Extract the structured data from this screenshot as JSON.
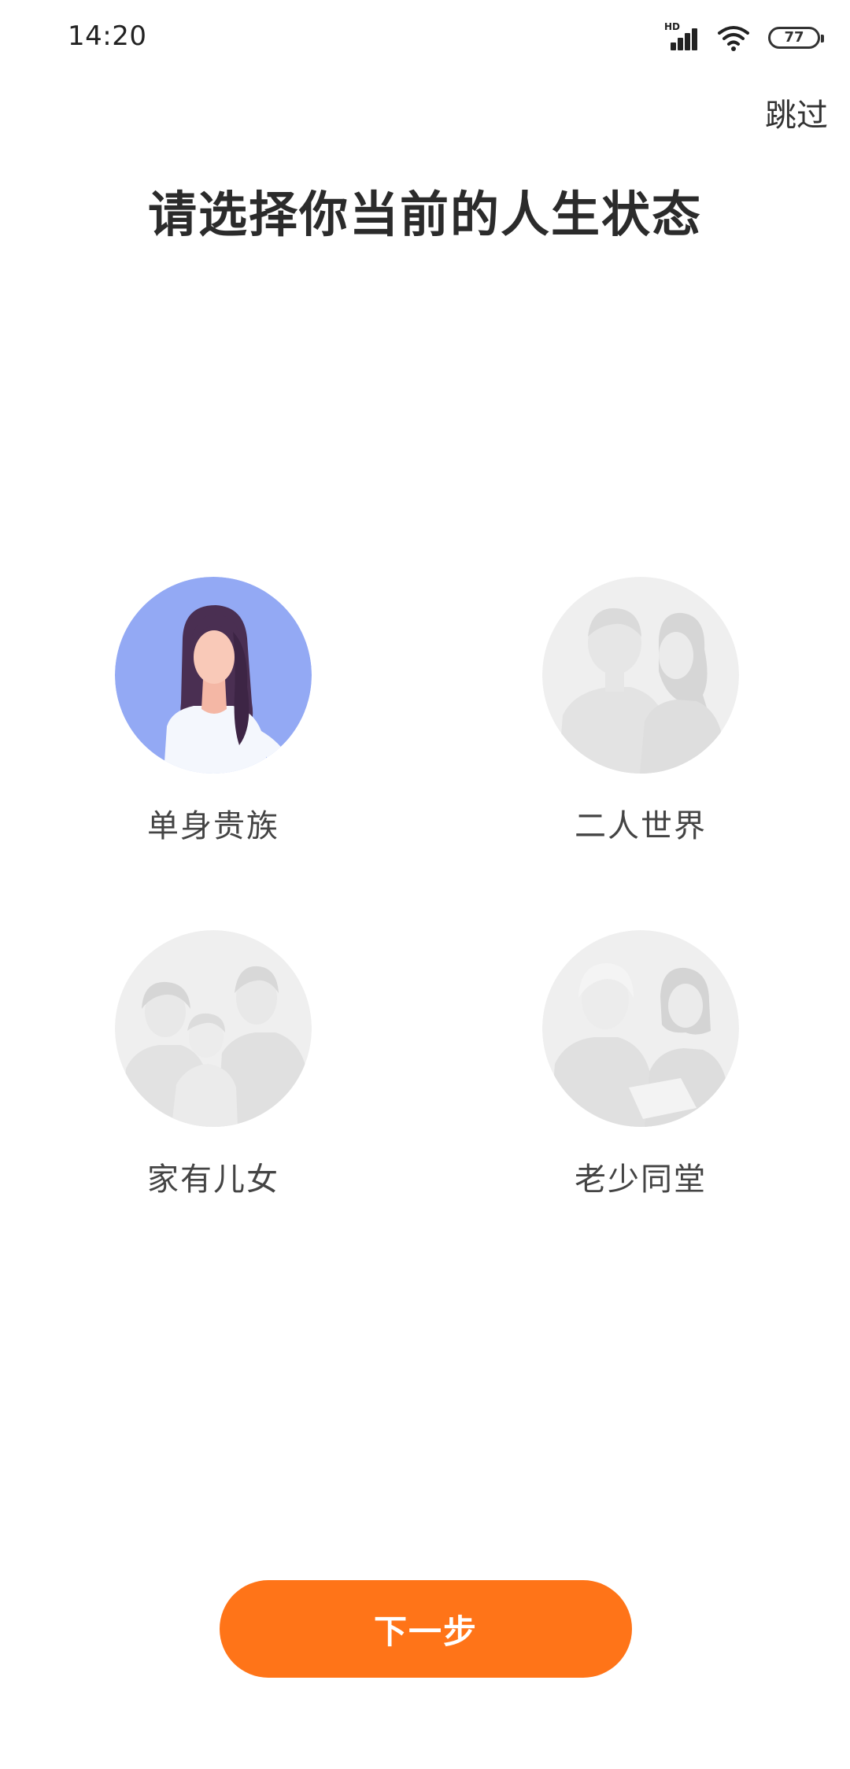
{
  "status_bar": {
    "time": "14:20",
    "network": "HD",
    "battery": "77"
  },
  "header": {
    "skip_label": "跳过",
    "title": "请选择你当前的人生状态"
  },
  "options": [
    {
      "label": "单身贵族",
      "selected": true,
      "icon": "single-woman-icon"
    },
    {
      "label": "二人世界",
      "selected": false,
      "icon": "couple-icon"
    },
    {
      "label": "家有儿女",
      "selected": false,
      "icon": "family-icon"
    },
    {
      "label": "老少同堂",
      "selected": false,
      "icon": "multi-generation-icon"
    }
  ],
  "footer": {
    "next_label": "下一步"
  },
  "colors": {
    "accent": "#ff7418",
    "selected_avatar_bg": "#93a9f4",
    "unselected_avatar_bg": "#efefef",
    "title_text": "#2b2b2b"
  }
}
